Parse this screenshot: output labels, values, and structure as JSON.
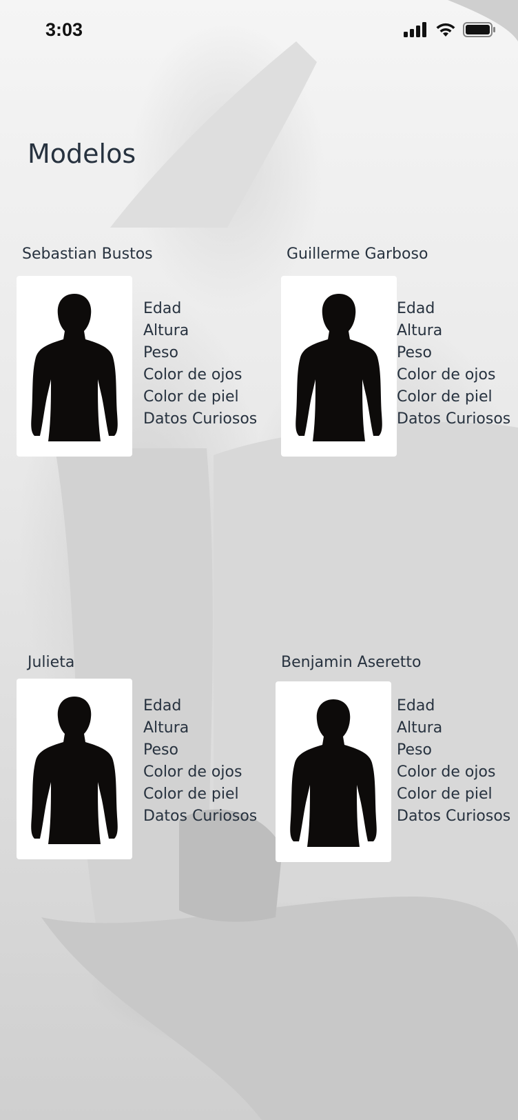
{
  "status_bar": {
    "time": "3:03",
    "icons": [
      "signal-icon",
      "wifi-icon",
      "battery-icon"
    ]
  },
  "page": {
    "title": "Modelos"
  },
  "attribute_labels": [
    "Edad",
    "Altura",
    "Peso",
    "Color de ojos",
    "Color de piel",
    "Datos Curiosos"
  ],
  "models": [
    {
      "name": "Sebastian Bustos"
    },
    {
      "name": "Guillerme Garboso"
    },
    {
      "name": "Julieta"
    },
    {
      "name": "Benjamin Aseretto"
    }
  ],
  "colors": {
    "text": "#27323f",
    "card_bg": "#ffffff",
    "silhouette": "#0d0b0a"
  }
}
